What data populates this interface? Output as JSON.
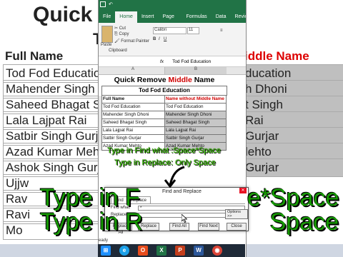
{
  "background": {
    "title": "Quick Re",
    "subtitle": "T",
    "left_header": "Full Name",
    "left_rows": [
      "Tod Fod Education",
      "Mahender Singh Dho",
      "Saheed Bhagat Sing",
      "Lala Lajpat Rai",
      "Satbir Singh Gurjar",
      "Azad Kumar Mehto",
      "Ashok Singh Gurjar",
      "Ujjw",
      "Rav",
      "Ravi",
      "Mo"
    ],
    "right_header": "iddle Name",
    "right_rows": [
      "ducation",
      "h Dhoni",
      "t Singh",
      "Rai",
      "Gurjar",
      "lehto",
      "Gurjar"
    ]
  },
  "excel": {
    "tabs": [
      "File",
      "Home",
      "Insert",
      "Page Layout",
      "Formulas",
      "Data",
      "Review"
    ],
    "active_tab": "Home",
    "ribbon": {
      "cut": "Cut",
      "copy": "Copy",
      "format_painter": "Format Painter",
      "paste": "Paste",
      "clipboard": "Clipboard",
      "font_name": "Calibri",
      "font_size": "11"
    },
    "formula_value": "Tod Fod Education",
    "columns": [
      "A",
      "B"
    ],
    "title": {
      "part1": "Quick Remove ",
      "highlight": "Middle",
      "part2": " Name"
    },
    "subtitle": "Tod Fod Education",
    "header_a": "Full Name",
    "header_b": "Name without Middle Name",
    "rows": [
      {
        "a": "Tod Fod Education",
        "b": "Tod Fod Education"
      },
      {
        "a": "Mahender Singh Dhoni",
        "b": "Mahender Singh Dhoni"
      },
      {
        "a": "Saheed Bhagat Singh",
        "b": "Saheed Bhagat Singh"
      },
      {
        "a": "Lala Lajpat Rai",
        "b": "Lala Lajpat Rai"
      },
      {
        "a": "Satbir Singh Gurjar",
        "b": "Satbir Singh Gurjar"
      },
      {
        "a": "Azad Kumar Mehto",
        "b": "Azad Kumar Mehto"
      }
    ],
    "status": "eady"
  },
  "dialog": {
    "title": "Find and Replace",
    "tab_find": "Find",
    "tab_replace": "Replace",
    "find_label": "Find what:",
    "find_value": "*",
    "replace_label": "Replace with:",
    "replace_value": "",
    "options": "Options >>",
    "btn_replace_all": "Replace All",
    "btn_replace": "Replace",
    "btn_find_all": "Find All",
    "btn_find_next": "Find Next",
    "btn_close": "Close"
  },
  "overlay": {
    "small1": "Type in Find what :Space*Space",
    "small2": "Type in Replace: Only Space",
    "big1": "Type in F",
    "big1b": "e*Space",
    "big2": "Type in R",
    "big2b": "Space"
  },
  "taskbar": {
    "icons": [
      "windows-icon",
      "ie-icon",
      "office-icon",
      "excel-icon",
      "powerpoint-icon",
      "word-icon",
      "chrome-icon"
    ]
  },
  "colors": {
    "excel_green": "#217346",
    "overlay_green": "#3ad000",
    "red_text": "#d00000"
  }
}
